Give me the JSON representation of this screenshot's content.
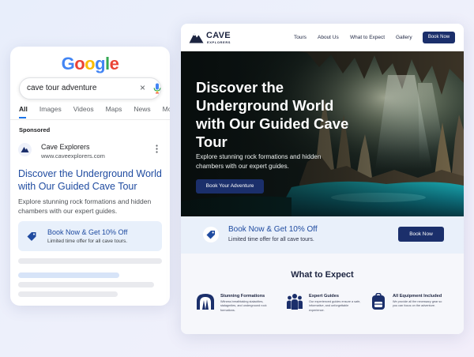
{
  "google": {
    "logo_letters": [
      {
        "ch": "G",
        "color": "#4285F4"
      },
      {
        "ch": "o",
        "color": "#EA4335"
      },
      {
        "ch": "o",
        "color": "#FBBC05"
      },
      {
        "ch": "g",
        "color": "#4285F4"
      },
      {
        "ch": "l",
        "color": "#34A853"
      },
      {
        "ch": "e",
        "color": "#EA4335"
      }
    ],
    "search_query": "cave tour adventure",
    "clear_icon": "×",
    "tabs": [
      "All",
      "Images",
      "Videos",
      "Maps",
      "News",
      "More"
    ],
    "sponsored_label": "Sponsored",
    "ad": {
      "name": "Cave Explorers",
      "url": "www.caveexplorers.com",
      "headline": "Discover the Underground World with Our Guided Cave Tour",
      "description": "Explore stunning rock formations and hidden chambers with our expert guides.",
      "promo_title": "Book Now & Get 10% Off",
      "promo_sub": "Limited time offer for all cave tours."
    }
  },
  "site": {
    "brand": "CAVE",
    "brand_sub": "EXPLORERS",
    "nav": [
      "Tours",
      "About Us",
      "What to Expect",
      "Gallery"
    ],
    "nav_cta": "Book Now",
    "hero": {
      "title": "Discover the Underground World with Our Guided Cave Tour",
      "subtitle": "Explore stunning rock formations and hidden chambers with our expert guides.",
      "cta": "Book Your Adventure"
    },
    "offer": {
      "title": "Book Now & Get 10% Off",
      "sub": "Limited time offer for all cave tours.",
      "cta": "Book Now"
    },
    "expect": {
      "title": "What to Expect",
      "features": [
        {
          "icon": "cave-arch-icon",
          "title": "Stunning Formations",
          "desc": "Witness breathtaking stalactites, stalagmites, and underground rock formations."
        },
        {
          "icon": "guides-group-icon",
          "title": "Expert Guides",
          "desc": "Our experienced guides ensure a safe, informative, and unforgettable experience."
        },
        {
          "icon": "backpack-icon",
          "title": "All Equipment Included",
          "desc": "We provide all the necessary gear so you can focus on the adventure."
        }
      ]
    }
  },
  "colors": {
    "brand_navy": "#1b2f6b",
    "link_blue": "#1f4ba0",
    "offer_bg": "#e9f0fa"
  }
}
